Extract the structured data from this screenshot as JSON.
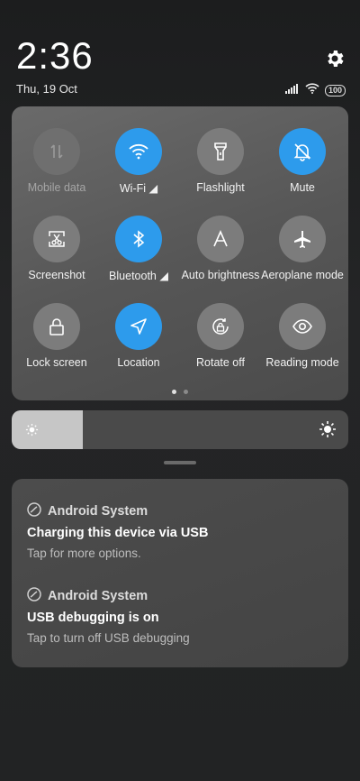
{
  "status_bar": {
    "time": "2:36",
    "date": "Thu, 19 Oct",
    "battery": "100"
  },
  "tiles": [
    {
      "label": "Mobile data",
      "state": "disabled",
      "icon": "mobile-data-icon"
    },
    {
      "label": "Wi-Fi ◢",
      "state": "on",
      "icon": "wifi-icon"
    },
    {
      "label": "Flashlight",
      "state": "off",
      "icon": "flashlight-icon"
    },
    {
      "label": "Mute",
      "state": "on",
      "icon": "mute-icon"
    },
    {
      "label": "Screenshot",
      "state": "off",
      "icon": "screenshot-icon"
    },
    {
      "label": "Bluetooth ◢",
      "state": "on",
      "icon": "bluetooth-icon"
    },
    {
      "label": "Auto brightness",
      "state": "off",
      "icon": "auto-brightness-icon"
    },
    {
      "label": "Aeroplane mode",
      "state": "off",
      "icon": "aeroplane-icon"
    },
    {
      "label": "Lock screen",
      "state": "off",
      "icon": "lock-icon"
    },
    {
      "label": "Location",
      "state": "on",
      "icon": "location-icon"
    },
    {
      "label": "Rotate off",
      "state": "off",
      "icon": "rotate-lock-icon"
    },
    {
      "label": "Reading mode",
      "state": "off",
      "icon": "eye-icon"
    }
  ],
  "pager": {
    "pages": 2,
    "current": 1
  },
  "brightness": {
    "level": 0.21
  },
  "notifications": [
    {
      "app": "Android System",
      "title": "Charging this device via USB",
      "body": "Tap for more options."
    },
    {
      "app": "Android System",
      "title": "USB debugging is on",
      "body": "Tap to turn off USB debugging"
    }
  ],
  "colors": {
    "accent": "#2d9bec",
    "tile_off": "#7c7c7c",
    "panel": "#5a5a5a"
  }
}
